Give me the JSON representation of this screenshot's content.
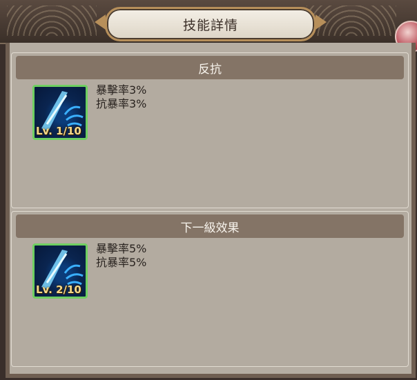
{
  "dialog": {
    "title": "技能詳情"
  },
  "current": {
    "header": "反抗",
    "level_label": "Lv. 1/10",
    "effects": [
      "暴擊率3%",
      "抗暴率3%"
    ]
  },
  "next": {
    "header": "下一級效果",
    "level_label": "Lv. 2/10",
    "effects": [
      "暴擊率5%",
      "抗暴率5%"
    ]
  },
  "colors": {
    "header_bar": "#847466",
    "panel": "#b3aba0",
    "icon_border": "#6ecf60",
    "title_border": "#b78f5a"
  },
  "icons": {
    "skill": "blue-slash-skill-icon",
    "close": "close-gem-icon"
  }
}
